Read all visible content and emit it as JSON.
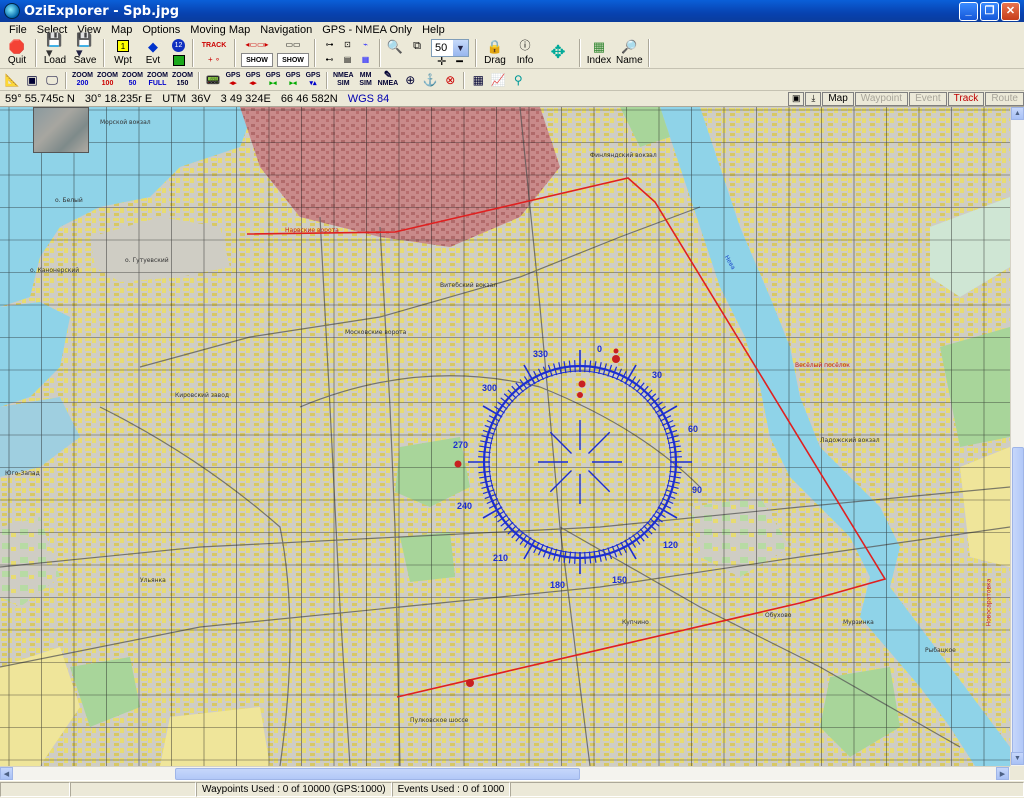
{
  "window": {
    "title": "OziExplorer - Spb.jpg"
  },
  "menu": [
    "File",
    "Select",
    "View",
    "Map",
    "Options",
    "Moving Map",
    "Navigation",
    "GPS - NMEA Only",
    "Help"
  ],
  "toolbar1": {
    "quit": "Quit",
    "load": "Load",
    "save": "Save",
    "wpt": "Wpt",
    "evt": "Evt",
    "evt_badge": "12",
    "track_badge": "TRACK",
    "show1": "SHOW",
    "show2": "SHOW",
    "zoom_value": "50",
    "drag": "Drag",
    "info": "Info",
    "index": "Index",
    "name": "Name"
  },
  "toolbar2": {
    "zoom200_a": "ZOOM",
    "zoom200_b": "200",
    "zoom100_a": "ZOOM",
    "zoom100_b": "100",
    "zoom50_a": "ZOOM",
    "zoom50_b": "50",
    "zoomfull_a": "ZOOM",
    "zoomfull_b": "FULL",
    "zoom150_a": "ZOOM",
    "zoom150_b": "150",
    "gps1": "GPS",
    "gps2": "GPS",
    "gps3": "GPS",
    "gps4": "GPS",
    "gps5": "GPS",
    "nmea_sim_a": "NMEA",
    "nmea_sim_b": "SIM",
    "mm_a": "MM",
    "mm_b": "SIM",
    "nmea": "NMEA"
  },
  "status": {
    "latitude": "59° 55.745c N",
    "longitude": "30° 18.235r E",
    "utm": "UTM",
    "zone": "36V",
    "easting": "3 49 324E",
    "northing": "66 46 582N",
    "datum": "WGS 84",
    "buttons": {
      "map": "Map",
      "waypoint": "Waypoint",
      "event": "Event",
      "track": "Track",
      "route": "Route"
    }
  },
  "map_labels": {
    "a": "Морской вокзал",
    "b": "о. Белый",
    "c": "о. Гутуевский",
    "d": "о. Канонерский",
    "e": "Нарвские ворота",
    "f": "Московские ворота",
    "g": "Кировский завод",
    "h": "Юго-Запад",
    "i": "Купчино",
    "j": "Обухово",
    "k": "Весёлый посёлок",
    "l": "Рыбацкое",
    "m": "Нева",
    "n": "Ладожский вокзал",
    "o": "Новосаратовка",
    "p": "Мурзинка",
    "q": "Ульянка",
    "r": "Пулковское шоссе",
    "s": "Финляндский вокзал",
    "t": "Витебский вокзал"
  },
  "compass": {
    "labels": [
      "0",
      "30",
      "60",
      "90",
      "120",
      "150",
      "180",
      "210",
      "240",
      "270",
      "300",
      "330"
    ]
  },
  "colors": {
    "route_line": "#e02020",
    "compass": "#1d2ed0",
    "water": "#8fd3e8",
    "park": "#a8d59a",
    "block": "#e8dc77"
  },
  "bottom": {
    "waypoints": "Waypoints Used : 0 of 10000 (GPS:1000)",
    "events": "Events Used : 0 of 1000"
  }
}
